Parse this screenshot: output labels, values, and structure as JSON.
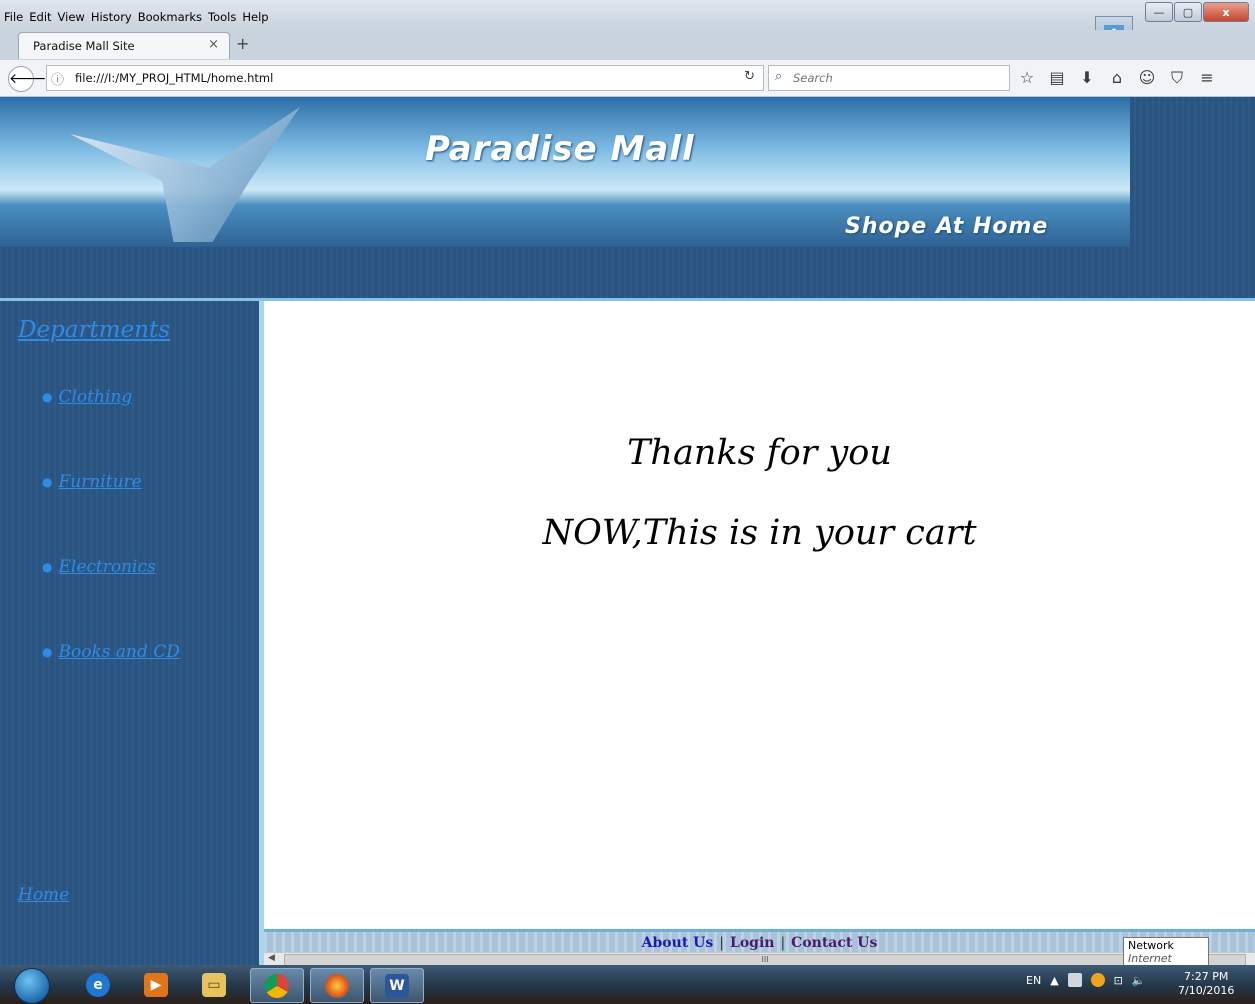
{
  "browser": {
    "menu": [
      "File",
      "Edit",
      "View",
      "History",
      "Bookmarks",
      "Tools",
      "Help"
    ],
    "tab_title": "Paradise Mall Site",
    "tab_close": "×",
    "new_tab": "+",
    "url": "file:///I:/MY_PROJ_HTML/home.html",
    "search_placeholder": "Search",
    "window_buttons": {
      "minimize": "—",
      "maximize": "▢",
      "close": "x"
    }
  },
  "banner": {
    "title": "Paradise Mall",
    "subtitle": "Shope At Home"
  },
  "sidebar": {
    "heading": "Departments",
    "items": [
      {
        "label": "Clothing"
      },
      {
        "label": "Furniture"
      },
      {
        "label": "Electronics"
      },
      {
        "label": "Books and CD"
      }
    ],
    "home": "Home"
  },
  "main": {
    "line1": "Thanks for you",
    "line2": "NOW,This is in your cart"
  },
  "footer": {
    "about": "About Us",
    "login": "Login",
    "contact": "Contact Us",
    "separator": "|"
  },
  "scrollbar": {
    "grip": "III"
  },
  "tooltip": {
    "title": "Network",
    "detail": "Internet access"
  },
  "taskbar": {
    "language": "EN",
    "time": "7:27 PM",
    "date": "7/10/2016",
    "apps": [
      "internet-explorer",
      "media-player",
      "file-explorer",
      "chrome",
      "firefox",
      "word"
    ]
  },
  "colors": {
    "banner_bg": "#2a5583",
    "link": "#2e8be6",
    "footer_about": "#1a1ab8",
    "footer_other": "#4a1a6a"
  }
}
